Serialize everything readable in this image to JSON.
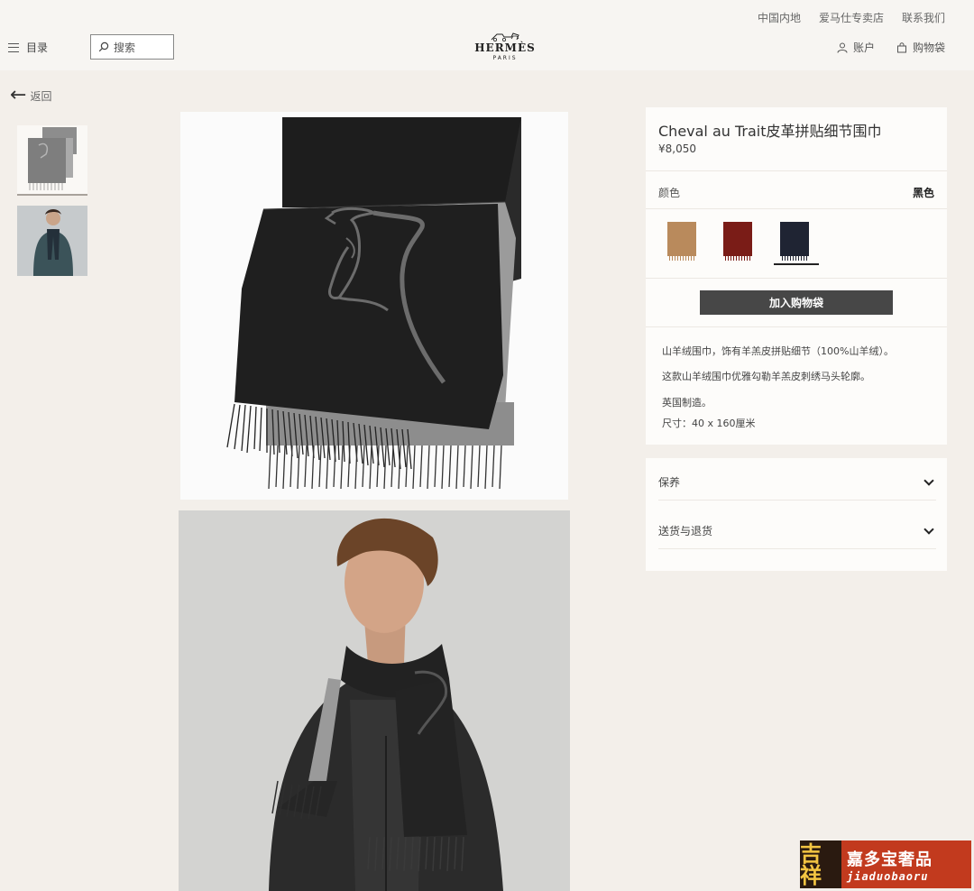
{
  "header": {
    "top_links": [
      "中国内地",
      "爱马仕专卖店",
      "联系我们"
    ],
    "menu_label": "目录",
    "search_placeholder": "搜索",
    "logo_brand": "HERMÈS",
    "logo_city": "PARIS",
    "account_label": "账户",
    "bag_label": "购物袋"
  },
  "back_label": "返回",
  "thumbnails": [
    "scarf-product",
    "scarf-model"
  ],
  "product": {
    "title": "Cheval au Trait皮革拼贴细节围巾",
    "price": "¥8,050",
    "color_label": "颜色",
    "color_value": "黑色",
    "swatches": [
      {
        "name": "camel",
        "color": "#b98a5c"
      },
      {
        "name": "burgundy",
        "color": "#7a1c17"
      },
      {
        "name": "black-navy",
        "color": "#1f2433",
        "selected": true
      }
    ],
    "add_to_bag": "加入购物袋",
    "description": [
      "山羊绒围巾，饰有羊羔皮拼贴细节（100%山羊绒）。",
      "这款山羊绒围巾优雅勾勒羊羔皮刺绣马头轮廓。",
      "英国制造。",
      "尺寸：40 x 160厘米"
    ]
  },
  "accordion": [
    "保养",
    "送货与退货"
  ],
  "watermark": {
    "mark": "吉祥",
    "chinese": "嘉多宝奢品",
    "latin": "jiaduobaoru"
  }
}
